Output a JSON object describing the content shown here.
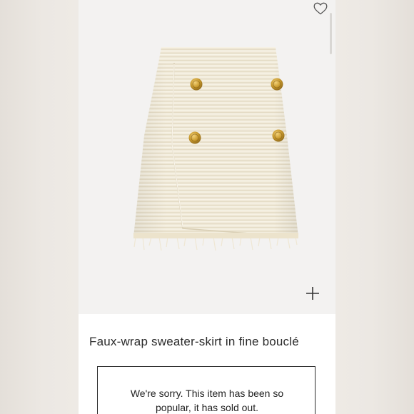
{
  "product": {
    "title": "Faux-wrap sweater-skirt in fine bouclé",
    "image_alt": "Cream bouclé faux-wrap mini skirt with four gold buttons",
    "soldout_message": "We're sorry. This item has been so popular, it has sold out."
  },
  "icons": {
    "wishlist": "heart-outline-icon",
    "zoom": "plus-icon"
  },
  "colors": {
    "fabric": "#f1ead8",
    "buttons": "#c99a2e",
    "text": "#2b2b2b"
  }
}
